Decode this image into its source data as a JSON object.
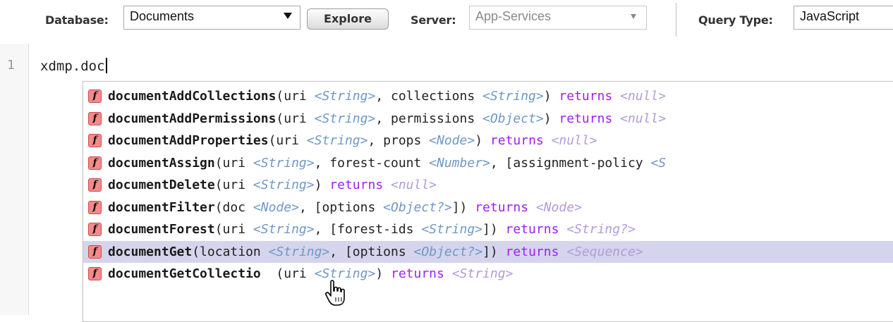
{
  "toolbar": {
    "database_label": "Database:",
    "database_value": "Documents",
    "explore_label": "Explore",
    "server_label": "Server:",
    "server_value": "App-Services",
    "query_type_label": "Query Type:",
    "query_type_value": "JavaScript"
  },
  "editor": {
    "line_number": "1",
    "code": "xdmp.doc"
  },
  "autocomplete": {
    "items": [
      {
        "icon": "f",
        "parts": [
          [
            "n",
            "documentAddCollections"
          ],
          [
            "p",
            "(uri "
          ],
          [
            "t",
            "<String>"
          ],
          [
            "p",
            ", collections "
          ],
          [
            "t",
            "<String>"
          ],
          [
            "p",
            ") "
          ],
          [
            "k",
            "returns "
          ],
          [
            "r",
            "<null>"
          ]
        ]
      },
      {
        "icon": "f",
        "parts": [
          [
            "n",
            "documentAddPermissions"
          ],
          [
            "p",
            "(uri "
          ],
          [
            "t",
            "<String>"
          ],
          [
            "p",
            ", permissions "
          ],
          [
            "t",
            "<Object>"
          ],
          [
            "p",
            ") "
          ],
          [
            "k",
            "returns "
          ],
          [
            "r",
            "<null>"
          ]
        ]
      },
      {
        "icon": "f",
        "parts": [
          [
            "n",
            "documentAddProperties"
          ],
          [
            "p",
            "(uri "
          ],
          [
            "t",
            "<String>"
          ],
          [
            "p",
            ", props "
          ],
          [
            "t",
            "<Node>"
          ],
          [
            "p",
            ") "
          ],
          [
            "k",
            "returns "
          ],
          [
            "r",
            "<null>"
          ]
        ]
      },
      {
        "icon": "f",
        "parts": [
          [
            "n",
            "documentAssign"
          ],
          [
            "p",
            "(uri "
          ],
          [
            "t",
            "<String>"
          ],
          [
            "p",
            ", forest-count "
          ],
          [
            "t",
            "<Number>"
          ],
          [
            "p",
            ", [assignment-policy "
          ],
          [
            "t",
            "<S"
          ]
        ]
      },
      {
        "icon": "f",
        "parts": [
          [
            "n",
            "documentDelete"
          ],
          [
            "p",
            "(uri "
          ],
          [
            "t",
            "<String>"
          ],
          [
            "p",
            ") "
          ],
          [
            "k",
            "returns "
          ],
          [
            "r",
            "<null>"
          ]
        ]
      },
      {
        "icon": "f",
        "parts": [
          [
            "n",
            "documentFilter"
          ],
          [
            "p",
            "(doc "
          ],
          [
            "t",
            "<Node>"
          ],
          [
            "p",
            ", [options "
          ],
          [
            "t",
            "<Object?>"
          ],
          [
            "p",
            "]) "
          ],
          [
            "k",
            "returns "
          ],
          [
            "r",
            "<Node>"
          ]
        ]
      },
      {
        "icon": "f",
        "parts": [
          [
            "n",
            "documentForest"
          ],
          [
            "p",
            "(uri "
          ],
          [
            "t",
            "<String>"
          ],
          [
            "p",
            ", [forest-ids "
          ],
          [
            "t",
            "<String>"
          ],
          [
            "p",
            "]) "
          ],
          [
            "k",
            "returns "
          ],
          [
            "r",
            "<String?>"
          ]
        ]
      },
      {
        "icon": "f",
        "parts": [
          [
            "n",
            "documentGet"
          ],
          [
            "p",
            "(location "
          ],
          [
            "t",
            "<String>"
          ],
          [
            "p",
            ", [options "
          ],
          [
            "t",
            "<Object?>"
          ],
          [
            "p",
            "]) "
          ],
          [
            "k",
            "returns "
          ],
          [
            "r",
            "<Sequence>"
          ]
        ]
      },
      {
        "icon": "f",
        "parts": [
          [
            "n",
            "documentGetCollectio"
          ],
          [
            "p",
            "  (uri "
          ],
          [
            "t",
            "<String>"
          ],
          [
            "p",
            ") "
          ],
          [
            "k",
            "returns "
          ],
          [
            "r",
            "<String>"
          ]
        ]
      }
    ],
    "active_index": 7
  },
  "colors": {
    "type_annotation": "#6e98c8",
    "keyword_returns": "#a020f0",
    "return_type": "#b39bd9",
    "selected_row": "#d4d4ec",
    "function_icon": "#f48a8a"
  },
  "icons": {
    "function": "function-icon",
    "dropdown": "chevron-down-icon",
    "pointer": "hand-pointer-icon"
  }
}
